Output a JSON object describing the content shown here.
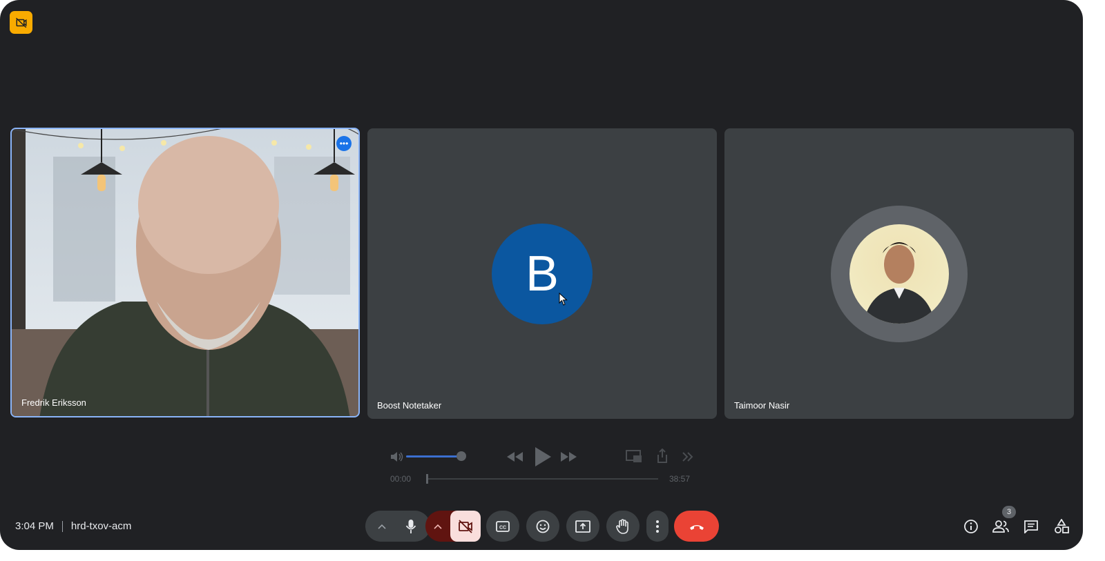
{
  "meeting": {
    "time": "3:04 PM",
    "code": "hrd-txov-acm",
    "participant_count": "3"
  },
  "participants": [
    {
      "name": "Fredrik Eriksson",
      "type": "video"
    },
    {
      "name": "Boost Notetaker",
      "initial": "B",
      "avatar_color": "#0b57a0"
    },
    {
      "name": "Taimoor Nasir",
      "type": "photo"
    }
  ],
  "player": {
    "current_time": "00:00",
    "duration": "38:57",
    "volume": 1.0,
    "progress": 0.0
  },
  "colors": {
    "background": "#202124",
    "tile": "#3c4043",
    "active_border": "#8ab4f8",
    "end_call": "#ea4335",
    "camera_off_bg": "#f9dedc",
    "camera_off_group": "#601410",
    "recording_badge": "#f9ab00"
  },
  "icons": [
    "recording-icon",
    "more-options-icon",
    "volume-icon",
    "rewind-icon",
    "play-icon",
    "fast-forward-icon",
    "pip-icon",
    "share-icon",
    "skip-icon",
    "chevron-up-icon",
    "mic-icon",
    "camera-off-icon",
    "captions-icon",
    "emoji-icon",
    "present-icon",
    "raise-hand-icon",
    "more-vert-icon",
    "end-call-icon",
    "info-icon",
    "people-icon",
    "chat-icon",
    "activities-icon"
  ]
}
